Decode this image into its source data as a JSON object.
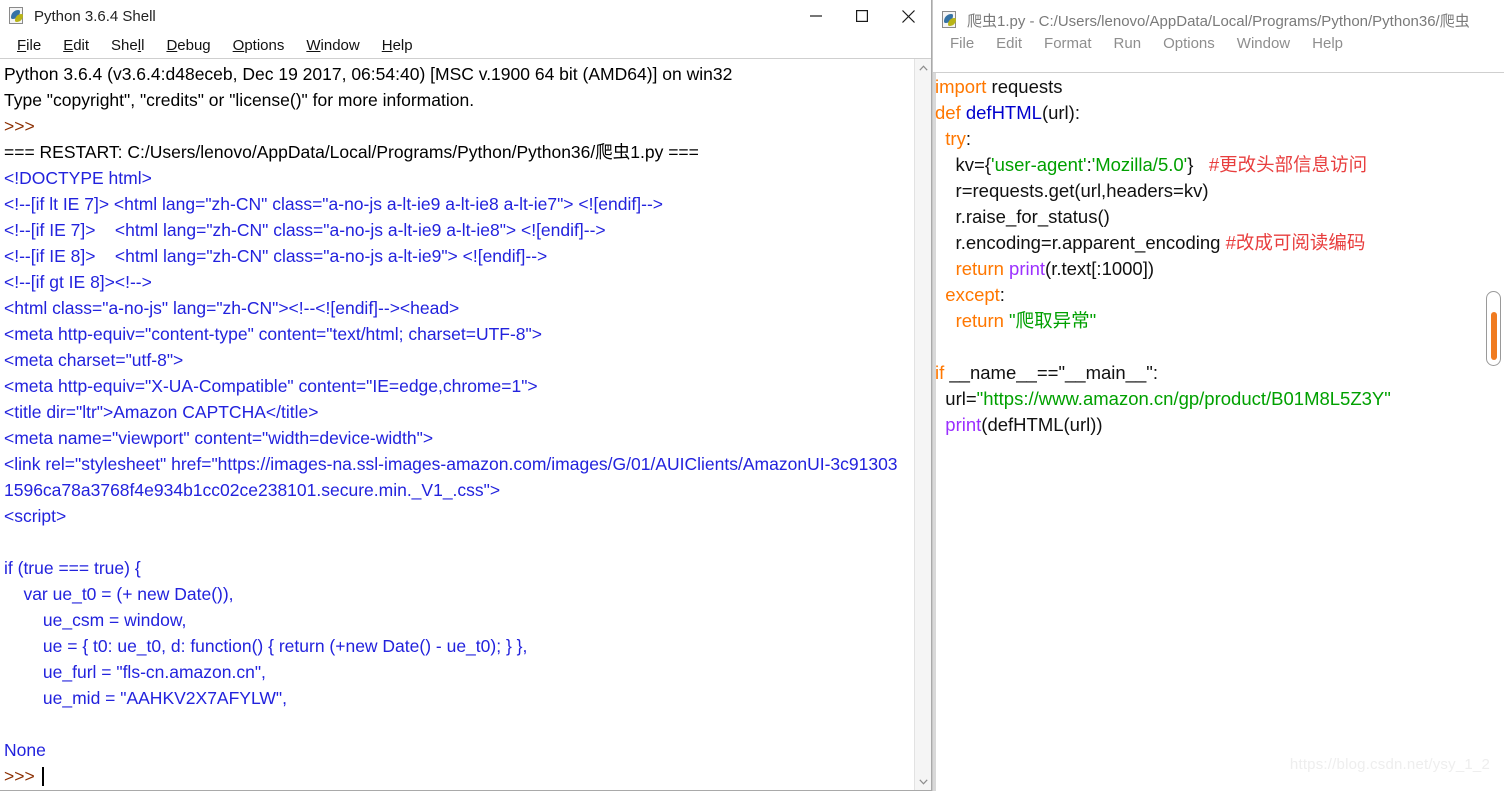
{
  "shell_window": {
    "title": "Python 3.6.4 Shell",
    "icon": "python-file-icon",
    "menu": [
      {
        "label": "File",
        "accel": "F"
      },
      {
        "label": "Edit",
        "accel": "E"
      },
      {
        "label": "Shell",
        "accel": "l"
      },
      {
        "label": "Debug",
        "accel": "D"
      },
      {
        "label": "Options",
        "accel": "O"
      },
      {
        "label": "Window",
        "accel": "W"
      },
      {
        "label": "Help",
        "accel": "H"
      }
    ],
    "window_controls": {
      "minimize": "minimize-icon",
      "maximize": "maximize-icon",
      "close": "close-icon"
    },
    "scrollbar": {
      "up_arrow": "chevron-up-icon",
      "down_arrow": "chevron-down-icon"
    },
    "output_lines": [
      {
        "color": "black",
        "text": "Python 3.6.4 (v3.6.4:d48eceb, Dec 19 2017, 06:54:40) [MSC v.1900 64 bit (AMD64)] on win32"
      },
      {
        "color": "black",
        "text": "Type \"copyright\", \"credits\" or \"license()\" for more information."
      },
      {
        "color": "prompt",
        "text": ">>> "
      },
      {
        "color": "black",
        "text": "=== RESTART: C:/Users/lenovo/AppData/Local/Programs/Python/Python36/爬虫1.py ==="
      },
      {
        "color": "blue",
        "text": "<!DOCTYPE html>"
      },
      {
        "color": "blue",
        "text": "<!--[if lt IE 7]> <html lang=\"zh-CN\" class=\"a-no-js a-lt-ie9 a-lt-ie8 a-lt-ie7\"> <![endif]-->"
      },
      {
        "color": "blue",
        "text": "<!--[if IE 7]>    <html lang=\"zh-CN\" class=\"a-no-js a-lt-ie9 a-lt-ie8\"> <![endif]-->"
      },
      {
        "color": "blue",
        "text": "<!--[if IE 8]>    <html lang=\"zh-CN\" class=\"a-no-js a-lt-ie9\"> <![endif]-->"
      },
      {
        "color": "blue",
        "text": "<!--[if gt IE 8]><!-->"
      },
      {
        "color": "blue",
        "text": "<html class=\"a-no-js\" lang=\"zh-CN\"><!--<![endif]--><head>"
      },
      {
        "color": "blue",
        "text": "<meta http-equiv=\"content-type\" content=\"text/html; charset=UTF-8\">"
      },
      {
        "color": "blue",
        "text": "<meta charset=\"utf-8\">"
      },
      {
        "color": "blue",
        "text": "<meta http-equiv=\"X-UA-Compatible\" content=\"IE=edge,chrome=1\">"
      },
      {
        "color": "blue",
        "text": "<title dir=\"ltr\">Amazon CAPTCHA</title>"
      },
      {
        "color": "blue",
        "text": "<meta name=\"viewport\" content=\"width=device-width\">"
      },
      {
        "color": "blue",
        "text": "<link rel=\"stylesheet\" href=\"https://images-na.ssl-images-amazon.com/images/G/01/AUIClients/AmazonUI-3c913031596ca78a3768f4e934b1cc02ce238101.secure.min._V1_.css\">"
      },
      {
        "color": "blue",
        "text": "<script>"
      },
      {
        "color": "blue",
        "text": ""
      },
      {
        "color": "blue",
        "text": "if (true === true) {"
      },
      {
        "color": "blue",
        "text": "    var ue_t0 = (+ new Date()),"
      },
      {
        "color": "blue",
        "text": "        ue_csm = window,"
      },
      {
        "color": "blue",
        "text": "        ue = { t0: ue_t0, d: function() { return (+new Date() - ue_t0); } },"
      },
      {
        "color": "blue",
        "text": "        ue_furl = \"fls-cn.amazon.cn\","
      },
      {
        "color": "blue",
        "text": "        ue_mid = \"AAHKV2X7AFYLW\","
      },
      {
        "color": "blue",
        "text": ""
      },
      {
        "color": "blue",
        "text": "None"
      }
    ],
    "final_prompt": ">>> ",
    "cursor_visible": true
  },
  "editor_window": {
    "title": "爬虫1.py - C:/Users/lenovo/AppData/Local/Programs/Python/Python36/爬虫",
    "icon": "python-file-icon",
    "menu": [
      {
        "label": "File"
      },
      {
        "label": "Edit"
      },
      {
        "label": "Format"
      },
      {
        "label": "Run"
      },
      {
        "label": "Options"
      },
      {
        "label": "Window"
      },
      {
        "label": "Help"
      }
    ],
    "scrollbar": {
      "thumb_color": "#f07b20"
    },
    "code_lines": [
      [
        {
          "t": "import ",
          "c": "kw"
        },
        {
          "t": "requests",
          "c": "plain"
        }
      ],
      [
        {
          "t": "def ",
          "c": "kw"
        },
        {
          "t": "defHTML",
          "c": "def"
        },
        {
          "t": "(url):",
          "c": "plain"
        }
      ],
      [
        {
          "t": "  ",
          "c": "plain"
        },
        {
          "t": "try",
          "c": "kw"
        },
        {
          "t": ":",
          "c": "plain"
        }
      ],
      [
        {
          "t": "    kv={",
          "c": "plain"
        },
        {
          "t": "'user-agent'",
          "c": "str"
        },
        {
          "t": ":",
          "c": "plain"
        },
        {
          "t": "'Mozilla/5.0'",
          "c": "str"
        },
        {
          "t": "}   ",
          "c": "plain"
        },
        {
          "t": "#更改头部信息访问",
          "c": "cmt"
        }
      ],
      [
        {
          "t": "    r=requests.get(url,headers=kv)",
          "c": "plain"
        }
      ],
      [
        {
          "t": "    r.raise_for_status()",
          "c": "plain"
        }
      ],
      [
        {
          "t": "    r.encoding=r.apparent_encoding ",
          "c": "plain"
        },
        {
          "t": "#改成可阅读编码",
          "c": "cmt"
        }
      ],
      [
        {
          "t": "    ",
          "c": "plain"
        },
        {
          "t": "return ",
          "c": "kw"
        },
        {
          "t": "print",
          "c": "builtin"
        },
        {
          "t": "(r.text[:1000])",
          "c": "plain"
        }
      ],
      [
        {
          "t": "  ",
          "c": "plain"
        },
        {
          "t": "except",
          "c": "kw"
        },
        {
          "t": ":",
          "c": "plain"
        }
      ],
      [
        {
          "t": "    ",
          "c": "plain"
        },
        {
          "t": "return ",
          "c": "kw"
        },
        {
          "t": "\"爬取异常\"",
          "c": "str"
        }
      ],
      [
        {
          "t": "",
          "c": "plain"
        }
      ],
      [
        {
          "t": "if ",
          "c": "kw"
        },
        {
          "t": "__name__==",
          "c": "plain"
        },
        {
          "t": "\"__main__\"",
          "c": "plain"
        },
        {
          "t": ":",
          "c": "plain"
        }
      ],
      [
        {
          "t": "  url=",
          "c": "plain"
        },
        {
          "t": "\"https://www.amazon.cn/gp/product/B01M8L5Z3Y\"",
          "c": "str"
        }
      ],
      [
        {
          "t": "  ",
          "c": "plain"
        },
        {
          "t": "print",
          "c": "builtin"
        },
        {
          "t": "(defHTML(url))",
          "c": "plain"
        }
      ]
    ]
  },
  "background_window": {
    "minimize": "minimize-icon",
    "maximize": "maximize-icon",
    "chevron": "chevron-down-icon",
    "accent_color": "#1b51a8"
  },
  "watermark": "https://blog.csdn.net/ysy_1_2"
}
